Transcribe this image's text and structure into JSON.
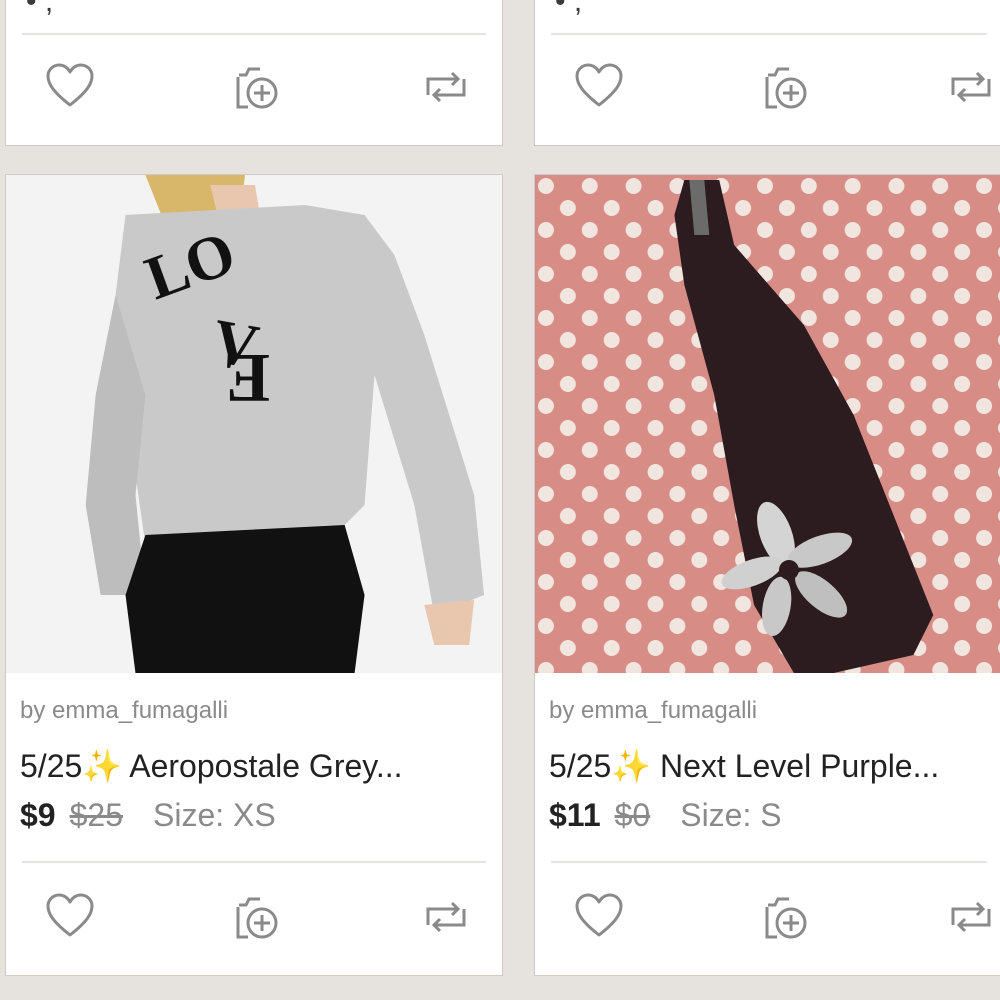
{
  "listings": [
    {
      "seller": "by emma_fumagalli",
      "title_prefix": "5/25",
      "sparkle": "✨",
      "title_text": "Aeropostale Grey...",
      "price": "$9",
      "original_price": "$25",
      "size": "Size: XS",
      "photo_desc": "grey-love-sweater",
      "sweater_text": "LOVE"
    },
    {
      "seller": "by emma_fumagalli",
      "title_prefix": "5/25",
      "sparkle": "✨",
      "title_text": "Next Level Purple...",
      "price": "$11",
      "original_price": "$0",
      "size": "Size: S",
      "photo_desc": "purple-dress-on-polka-dot-blanket"
    }
  ],
  "icons": {
    "like": "heart-icon",
    "share": "share-icon",
    "repost": "repost-icon"
  },
  "colors": {
    "background": "#e6e3df",
    "text": "#222222",
    "muted": "#8a8a8a",
    "icon": "#8a8a8a",
    "sparkle": "#f7c93a"
  }
}
